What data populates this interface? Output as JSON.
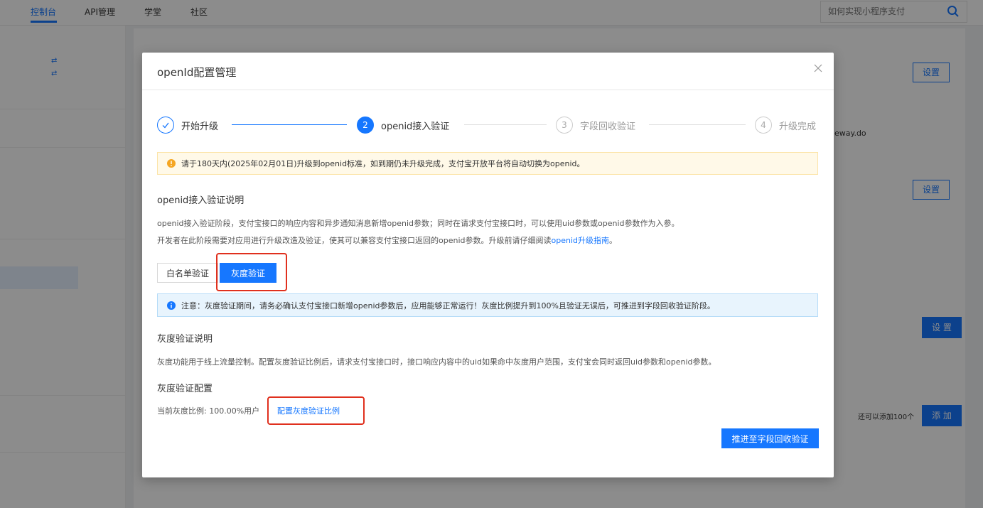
{
  "topnav": {
    "items": [
      "控制台",
      "API管理",
      "学堂",
      "社区"
    ],
    "search_placeholder": "如何实现小程序支付"
  },
  "background": {
    "set_label": "设置",
    "gateway_text": "eway.do",
    "add_hint": "还可以添加100个",
    "add_label": "添 加",
    "set_label_spaced": "设 置"
  },
  "modal": {
    "title": "openId配置管理",
    "steps": [
      {
        "num": "",
        "label": "开始升级",
        "state": "done"
      },
      {
        "num": "2",
        "label": "openid接入验证",
        "state": "active"
      },
      {
        "num": "3",
        "label": "字段回收验证",
        "state": "pending"
      },
      {
        "num": "4",
        "label": "升级完成",
        "state": "pending"
      }
    ],
    "warn_text": "请于180天内(2025年02月01日)升级到openid标准，如到期仍未升级完成，支付宝开放平台将自动切换为openid。",
    "section1_title": "openid接入验证说明",
    "para1": "openid接入验证阶段，支付宝接口的响应内容和异步通知消息新增openid参数；同时在请求支付宝接口时，可以使用uid参数或openid参数作为入参。",
    "para2_prefix": "开发者在此阶段需要对应用进行升级改造及验证，使其可以兼容支付宝接口返回的openid参数。升级前请仔细阅读",
    "para2_link": "openid升级指南",
    "para2_suffix": "。",
    "tabs": [
      "白名单验证",
      "灰度验证"
    ],
    "info_text": "注意：灰度验证期间，请务必确认支付宝接口新增openid参数后，应用能够正常运行！灰度比例提升到100%且验证无误后，可推进到字段回收验证阶段。",
    "section2_title": "灰度验证说明",
    "para3": "灰度功能用于线上流量控制。配置灰度验证比例后，请求支付宝接口时，接口响应内容中的uid如果命中灰度用户范围，支付宝会同时返回uid参数和openid参数。",
    "section3_title": "灰度验证配置",
    "ratio_text": "当前灰度比例: 100.00%用户",
    "ratio_link": "配置灰度验证比例",
    "primary_button": "推进至字段回收验证"
  },
  "colors": {
    "accent": "#1677ff",
    "highlight": "#e0301e",
    "warn_bg": "#fff9e8",
    "info_bg": "#e8f4fd"
  }
}
